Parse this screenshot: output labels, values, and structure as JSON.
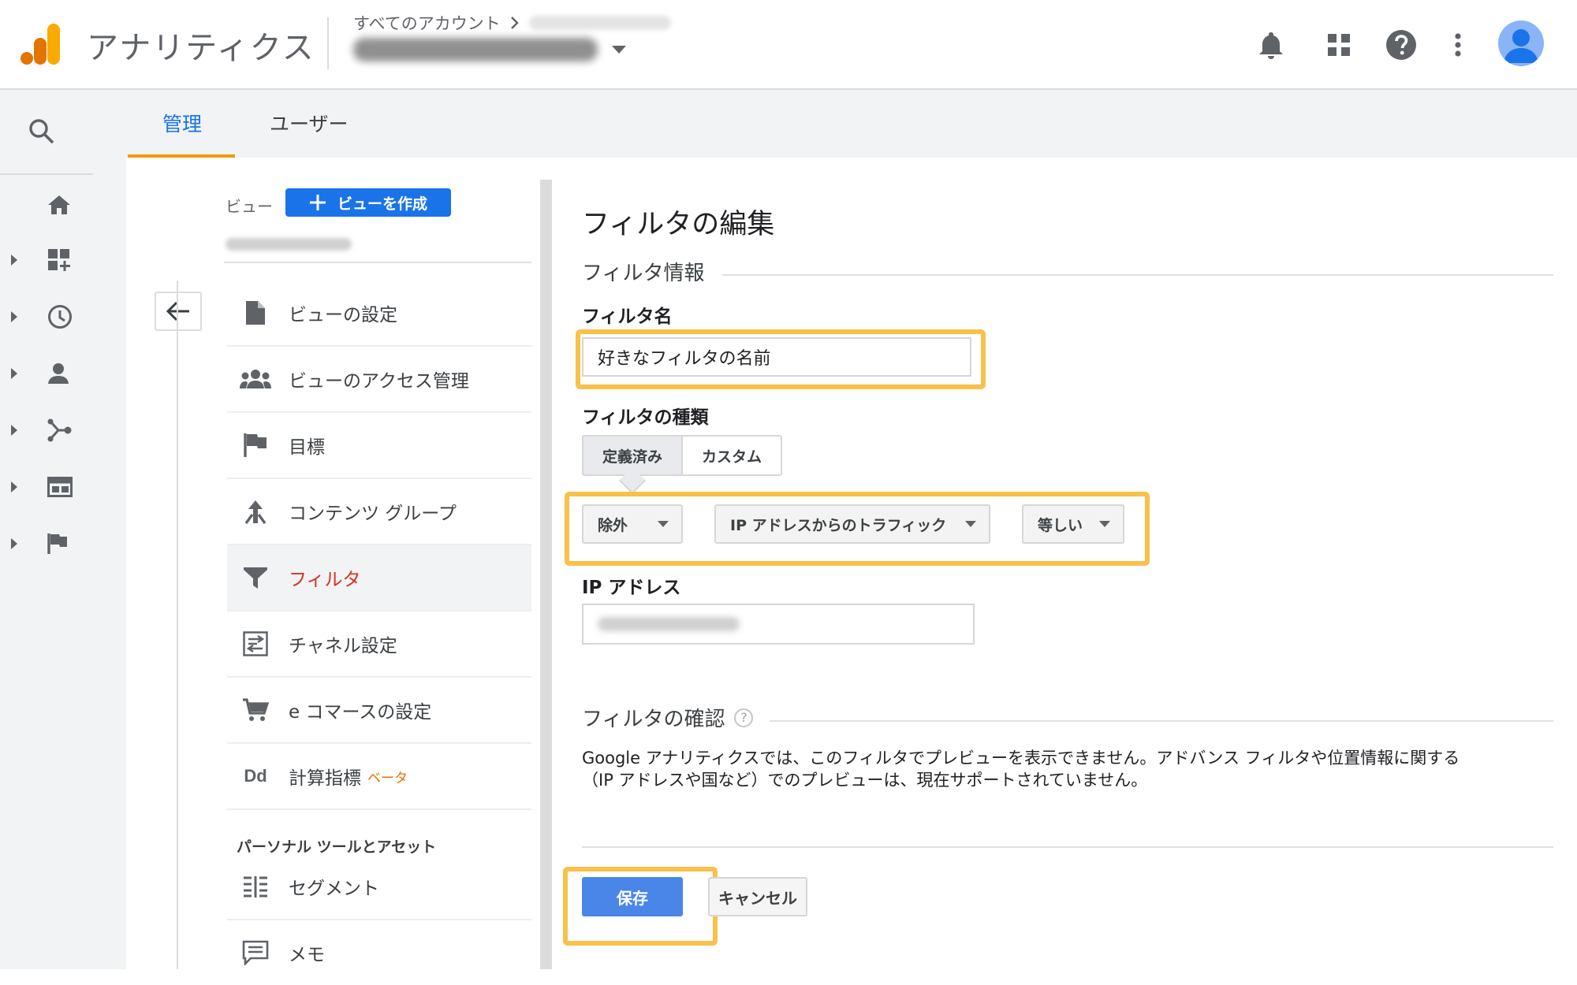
{
  "app": {
    "title": "アナリティクス",
    "breadcrumb": "すべてのアカウント",
    "brand_colors": {
      "logo_dark": "#e37400",
      "logo_light": "#f9ab00",
      "accent": "#1a73e8"
    }
  },
  "header_icons": [
    "notifications-icon",
    "apps-icon",
    "help-icon",
    "more-vert-icon",
    "account-avatar"
  ],
  "tabs": [
    {
      "label": "管理",
      "active": true
    },
    {
      "label": "ユーザー",
      "active": false
    }
  ],
  "view_column": {
    "view_label": "ビュー",
    "create_view_label": "ビューを作成",
    "items": [
      {
        "label": "ビューの設定",
        "icon": "file-icon"
      },
      {
        "label": "ビューのアクセス管理",
        "icon": "people-icon"
      },
      {
        "label": "目標",
        "icon": "flag-icon"
      },
      {
        "label": "コンテンツ グループ",
        "icon": "content-grouping-icon"
      },
      {
        "label": "フィルタ",
        "icon": "filter-icon",
        "selected": true
      },
      {
        "label": "チャネル設定",
        "icon": "channel-settings-icon"
      },
      {
        "label": "e コマースの設定",
        "icon": "cart-icon"
      },
      {
        "label": "計算指標",
        "icon": "dd-icon",
        "badge": "ベータ"
      }
    ],
    "personal_section": "パーソナル ツールとアセット",
    "personal_items": [
      {
        "label": "セグメント",
        "icon": "segments-icon"
      },
      {
        "label": "メモ",
        "icon": "annotations-icon"
      }
    ]
  },
  "form": {
    "title": "フィルタの編集",
    "section_info": "フィルタ情報",
    "name_label": "フィルタ名",
    "name_value": "好きなフィルタの名前",
    "type_label": "フィルタの種類",
    "type_options": [
      "定義済み",
      "カスタム"
    ],
    "type_selected": "定義済み",
    "dropdown_action": "除外",
    "dropdown_source": "IP アドレスからのトラフィック",
    "dropdown_expression": "等しい",
    "ip_label": "IP アドレス",
    "section_verify": "フィルタの確認",
    "help_mark": "?",
    "note_line1": "Google アナリティクスでは、このフィルタでプレビューを表示できません。アドバンス フィルタや位置情報に関する",
    "note_line2": "（IP アドレスや国など）でのプレビューは、現在サポートされていません。",
    "save_label": "保存",
    "cancel_label": "キャンセル",
    "highlight_color": "#f9c04a"
  }
}
